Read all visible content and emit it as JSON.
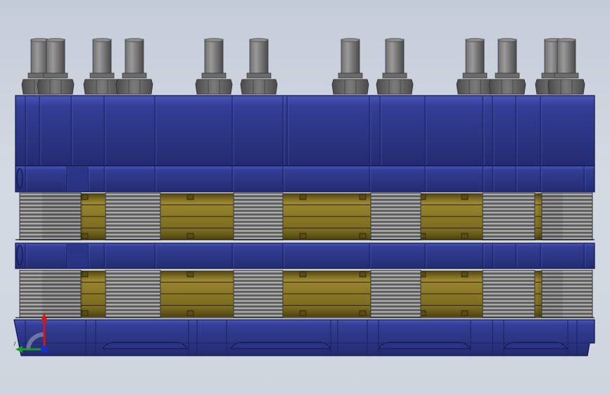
{
  "viewport": {
    "background_top": "#c4ccd8",
    "background_bottom": "#cfd5de"
  },
  "colors": {
    "blue_plate": "#333e96",
    "blue_plate_dark": "#232c70",
    "blue_plate_light": "#4a57b8",
    "brass": "#7a6a1e",
    "brass_dark": "#4e4210",
    "brass_light": "#9a8630",
    "spring": "#8e8e8e",
    "spring_light": "#c8c8c8",
    "bolt": "#6e6e6e",
    "bolt_light": "#9a9a9a",
    "nut": "#5e5e5e",
    "axis_x": "#1a9a2a",
    "axis_y": "#d01818",
    "axis_z": "#1830c8"
  },
  "model": {
    "bolt_columns": 12,
    "spring_columns": 6,
    "spring_layers": 2,
    "clamp_plates": 4
  },
  "triad": {
    "icon": "coordinate-triad-icon",
    "x_axis": "x-axis-arrow",
    "y_axis": "y-axis-arrow",
    "z_axis": "z-axis-dot"
  }
}
